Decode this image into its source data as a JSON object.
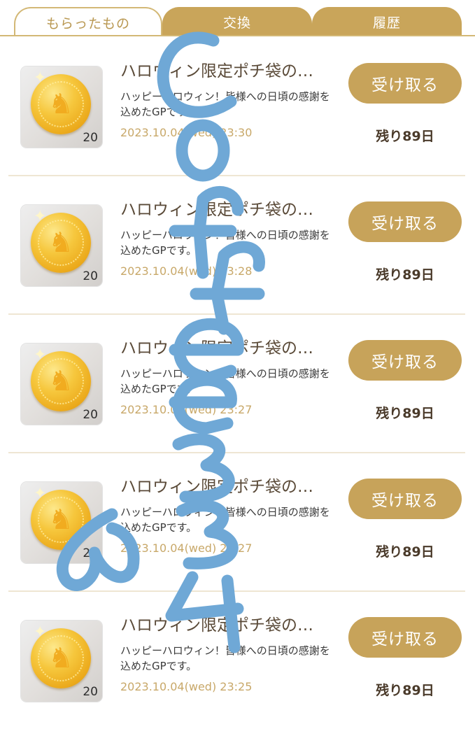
{
  "tabs": [
    {
      "label": "もらったもの",
      "active": true
    },
    {
      "label": "交換",
      "active": false
    },
    {
      "label": "履歴",
      "active": false
    }
  ],
  "items": [
    {
      "title": "ハロウィン限定ポチ袋の…",
      "description": "ハッピーハロウィン！皆様への日頃の感謝を込めたGPです。",
      "date": "2023.10.04(wed) 23:30",
      "quantity": "20",
      "button": "受け取る",
      "remaining": "残り89日"
    },
    {
      "title": "ハロウィン限定ポチ袋の…",
      "description": "ハッピーハロウィン！皆様への日頃の感謝を込めたGPです。",
      "date": "2023.10.04(wed) 23:28",
      "quantity": "20",
      "button": "受け取る",
      "remaining": "残り89日"
    },
    {
      "title": "ハロウィン限定ポチ袋の…",
      "description": "ハッピーハロウィン！皆様への日頃の感謝を込めたGPです。",
      "date": "2023.10.04(wed) 23:27",
      "quantity": "20",
      "button": "受け取る",
      "remaining": "残り89日"
    },
    {
      "title": "ハロウィン限定ポチ袋の…",
      "description": "ハッピーハロウィン！皆様への日頃の感謝を込めたGPです。",
      "date": "2023.10.04(wed) 23:27",
      "quantity": "20",
      "button": "受け取る",
      "remaining": "残り89日"
    },
    {
      "title": "ハロウィン限定ポチ袋の…",
      "description": "ハッピーハロウィン！皆様への日頃の感謝を込めたGPです。",
      "date": "2023.10.04(wed) 23:25",
      "quantity": "20",
      "button": "受け取る",
      "remaining": "残り89日"
    }
  ],
  "overlay_text": "Coffee334",
  "colors": {
    "accent": "#c7a35a",
    "tab_inactive": "#c9a55a",
    "date": "#c8a869",
    "overlay": "#6fa8d6"
  },
  "icons": {
    "thumbnail": "gold-coin-icon"
  }
}
